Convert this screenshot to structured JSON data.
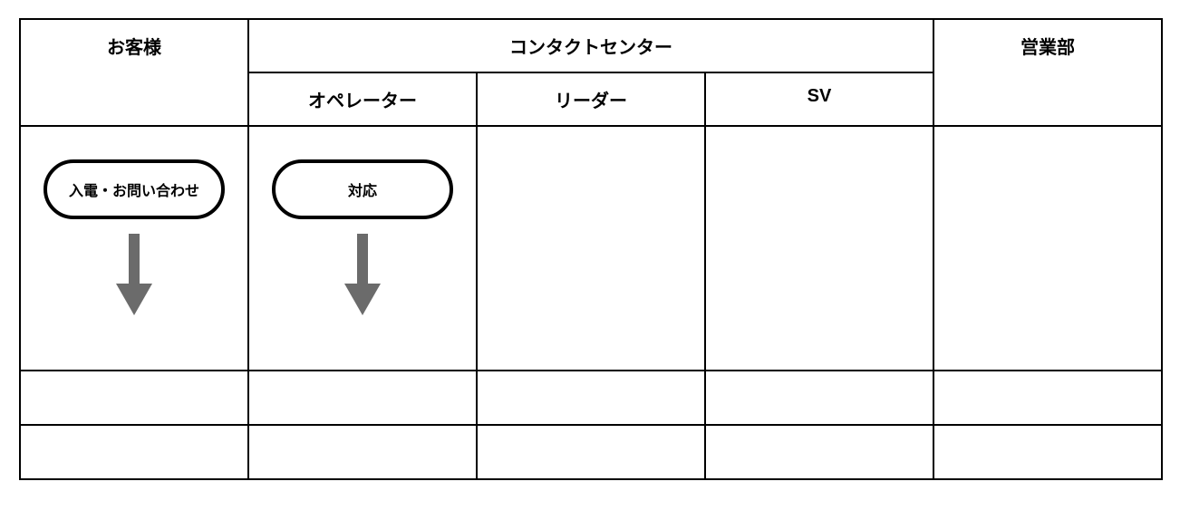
{
  "lanes": {
    "customer": "お客様",
    "contact_center": "コンタクトセンター",
    "operator": "オペレーター",
    "leader": "リーダー",
    "sv": "SV",
    "sales": "営業部"
  },
  "nodes": {
    "incoming": "入電・お問い合わせ",
    "handle": "対応"
  },
  "arrow_color": "#6b6b6b"
}
